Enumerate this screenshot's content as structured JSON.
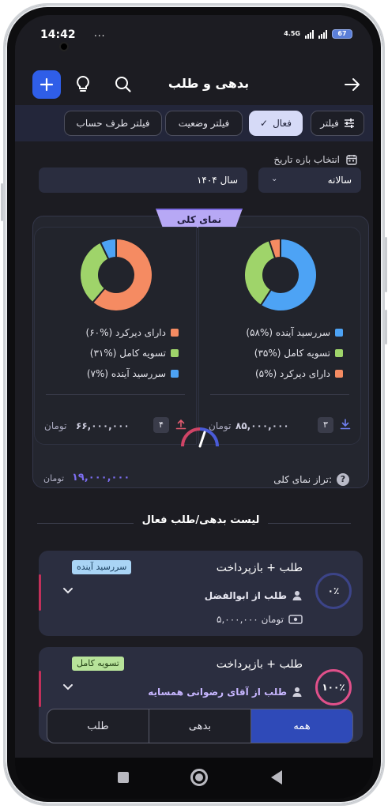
{
  "status": {
    "time": "14:42",
    "dots": "...",
    "network": "4.5G",
    "battery": "67"
  },
  "header": {
    "title": "بدهی و طلب"
  },
  "filters": {
    "filter_label": "فیلتر",
    "active_label": "فعال",
    "status_label": "فیلتر وضعیت",
    "account_label": "فیلتر طرف حساب"
  },
  "date": {
    "label": "انتخاب بازه تاریخ",
    "period": "سالانه",
    "year": "سال ۱۴۰۴"
  },
  "overview": {
    "tag": "نمای کلی",
    "receivable": {
      "segments": [
        {
          "label": "سررسید آینده (%۵۸)",
          "value": 58,
          "color": "#4da3f5"
        },
        {
          "label": "تسویه کامل (%۳۵)",
          "value": 35,
          "color": "#9fd46a"
        },
        {
          "label": "دارای دیرکرد (%۵)",
          "value": 5,
          "color": "#f58b62"
        }
      ],
      "count": "۳",
      "amount": "۸۵,۰۰۰,۰۰۰",
      "unit": "تومان"
    },
    "payable": {
      "segments": [
        {
          "label": "دارای دیرکرد (%۶۰)",
          "value": 60,
          "color": "#f58b62"
        },
        {
          "label": "تسویه کامل (%۳۱)",
          "value": 31,
          "color": "#9fd46a"
        },
        {
          "label": "سررسید آینده (%۷)",
          "value": 7,
          "color": "#4da3f5"
        }
      ],
      "count": "۴",
      "amount": "۶۶,۰۰۰,۰۰۰",
      "unit": "تومان"
    },
    "balance_label": "تراز نمای کلی:",
    "balance_value": "۱۹,۰۰۰,۰۰۰",
    "balance_unit": "تومان"
  },
  "list": {
    "title": "لیست بدهی/طلب فعال",
    "items": [
      {
        "title": "طلب + بازپرداخت",
        "subtitle": "طلب از ابوالفضل",
        "amount": "۵,۰۰۰,۰۰۰ تومان",
        "badge": "سررسید آینده",
        "progress": "۰٪",
        "progress_value": 0
      },
      {
        "title": "طلب + بازپرداخت",
        "subtitle": "طلب از آقای رضوانی همسایه",
        "badge": "تسویه کامل",
        "progress": "۱۰۰٪",
        "progress_value": 100
      }
    ]
  },
  "segment": {
    "all": "همه",
    "debt": "بدهی",
    "credit": "طلب"
  },
  "colors": {
    "accent": "#2f5ee8",
    "purple": "#7d6ef2",
    "late": "#f58b62",
    "settled": "#9fd46a",
    "upcoming": "#4da3f5"
  }
}
